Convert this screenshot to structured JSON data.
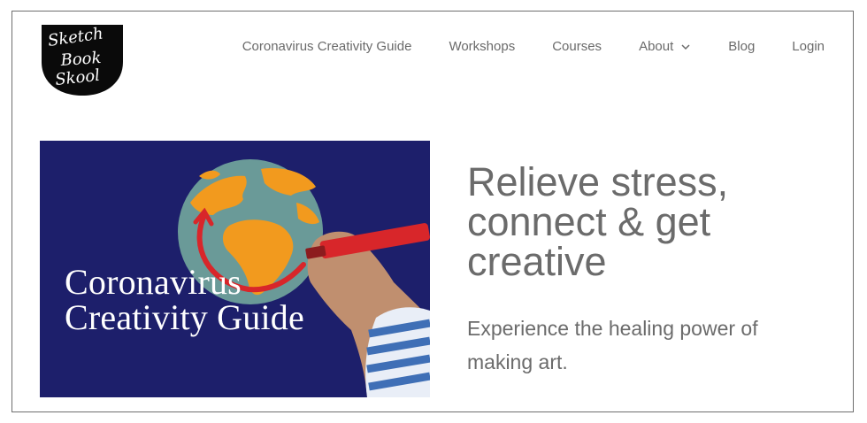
{
  "brand": {
    "logo_text": [
      "Sketch",
      "Book",
      "Skool"
    ]
  },
  "nav": {
    "items": [
      {
        "label": "Coronavirus Creativity Guide"
      },
      {
        "label": "Workshops"
      },
      {
        "label": "Courses"
      },
      {
        "label": "About",
        "icon": "chevron-down-icon"
      },
      {
        "label": "Blog"
      },
      {
        "label": "Login"
      }
    ]
  },
  "hero": {
    "image_caption_line1": "Coronavirus",
    "image_caption_line2": "Creativity Guide",
    "headline_line1": "Relieve stress,",
    "headline_line2": "connect & get",
    "headline_line3": "creative",
    "subtext_line1": "Experience the healing power of",
    "subtext_line2": "making art."
  },
  "colors": {
    "text": "#6b6b6b",
    "image_background": "#1d1f6b",
    "globe_ocean": "#6a9a98",
    "globe_land": "#f29a1e",
    "marker_red": "#d8262a"
  }
}
